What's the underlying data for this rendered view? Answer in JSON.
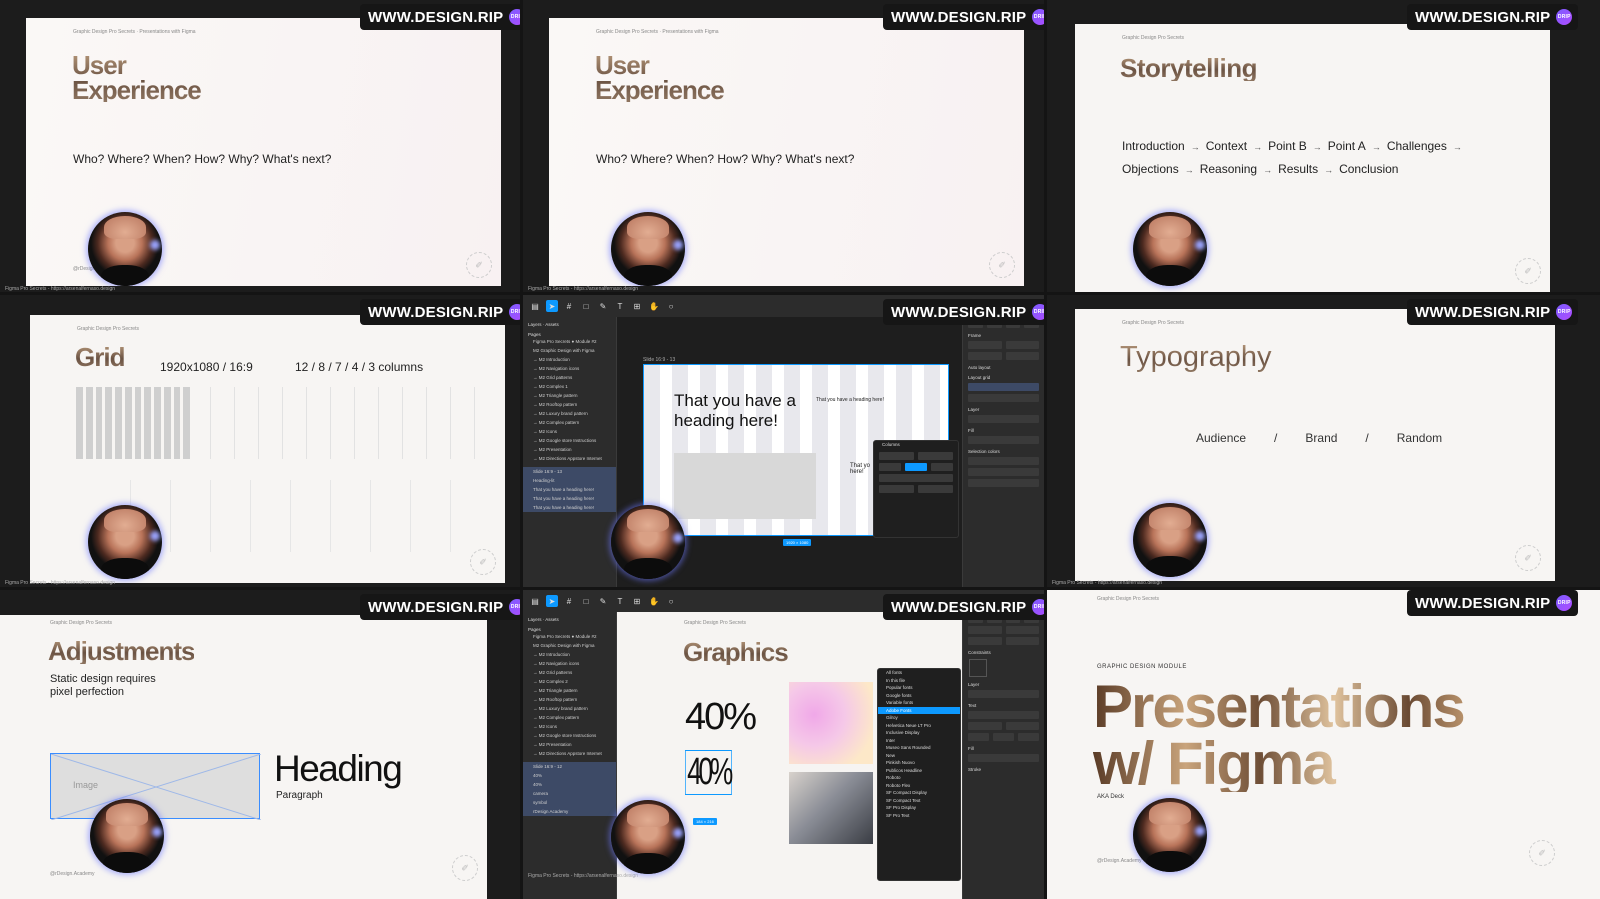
{
  "watermark": {
    "text": "WWW.DESIGN.RIP",
    "badge": "DRIP"
  },
  "common": {
    "course_label": "Graphic Design Pro Secrets",
    "footer_url": "Figma Pro Secrets - https://arsenalfernaso.design",
    "presenter_handle": "@rDesign.Academy",
    "seal": "✐"
  },
  "slide1": {
    "title_line1": "User",
    "title_line2": "Experience",
    "subtitle": "Who? Where? When? How? Why? What's next?",
    "breadcrumb": "Graphic Design Pro Secrets · Presentations with Figma"
  },
  "slide2": {
    "title_line1": "User",
    "title_line2": "Experience",
    "subtitle": "Who? Where? When? How? Why? What's next?",
    "breadcrumb": "Graphic Design Pro Secrets · Presentations with Figma"
  },
  "slide3": {
    "title": "Storytelling",
    "row1": [
      "Introduction",
      "Context",
      "Point B",
      "Point A",
      "Challenges"
    ],
    "row2": [
      "Objections",
      "Reasoning",
      "Results",
      "Conclusion"
    ],
    "arrow": "→"
  },
  "slide4": {
    "title": "Grid",
    "spec": "1920x1080 / 16:9",
    "columns": "12 / 8 / 7 / 4 / 3 columns"
  },
  "editor1": {
    "canvas_heading": "That you have a heading here!",
    "small_heading": "That you have a heading here!",
    "partial_text": "That yo here!",
    "frame_label": "Slide 16:9 - 13",
    "size_badge": "1920 × 1080",
    "dialog_title": "Columns",
    "layers": [
      "Figma Pro Secrets ● Module #2",
      "M2 Graphic Design with Figma",
      "→ M2 Introduction",
      "→ M2 Navigation icons",
      "→ M2 Grid patterns",
      "→ M2 Complex 1",
      "→ M2 Triangle pattern",
      "→ M2 Rooftop pattern",
      "→ M2 Luxury brand pattern",
      "→ M2 Complex pattern",
      "→ M2 Icons",
      "→ M2 Google store Instructions",
      "→ M2 Presentation",
      "→ M2 Directions Appstore Internet"
    ],
    "selected_layers": [
      "Slide 16:9 - 13",
      "Heading-lit",
      "That you have a heading here!",
      "That you have a heading here!",
      "That you have a heading here!"
    ]
  },
  "slide6": {
    "title": "Typography",
    "items": [
      "Audience",
      "Brand",
      "Random"
    ],
    "separator": "/"
  },
  "slide7": {
    "title": "Adjustments",
    "subtitle_line1": "Static design requires",
    "subtitle_line2": "pixel perfection",
    "image_label": "Image",
    "heading": "Heading",
    "paragraph": "Paragraph"
  },
  "editor2": {
    "slide_title": "Graphics",
    "stat_big": "40%",
    "stat_condensed": "40%",
    "frame_size": "184 × 216",
    "fonts": [
      "Gilroy",
      "Helvetica Neue LT Pro",
      "Inclusive Display",
      "Inter",
      "Museo Sans Rounded",
      "New",
      "Pinkish Nuovo",
      "Publicos Headline",
      "Roboto",
      "Roboto Flex",
      "SF Compact Display",
      "SF Compact Text",
      "SF Pro Display",
      "SF Pro Text"
    ],
    "font_headers": [
      "All fonts",
      "In this file",
      "Popular fonts",
      "Google fonts",
      "Variable fonts"
    ],
    "selected_font": "Adobe Fonts",
    "layers": [
      "Figma Pro Secrets ● Module #2",
      "M2 Graphic Design with Figma",
      "→ M2 Introduction",
      "→ M2 Navigation icons",
      "→ M2 Grid patterns",
      "→ M2 Complex 2",
      "→ M2 Triangle pattern",
      "→ M2 Rooftop pattern",
      "→ M2 Luxury brand pattern",
      "→ M2 Complex pattern",
      "→ M2 Icons",
      "→ M2 Google store Instructions",
      "→ M2 Presentation",
      "→ M2 Directions Appstore Internet"
    ],
    "selected_layers": [
      "Slide 16:9 - 12",
      "40%",
      "40%",
      "camera",
      "symbol",
      "rDesign Academy"
    ]
  },
  "slide9": {
    "module_label": "GRAPHIC DESIGN MODULE",
    "title_line1": "Presentations",
    "title_line2": "w/ Figma",
    "aka": "AKA Deck"
  }
}
